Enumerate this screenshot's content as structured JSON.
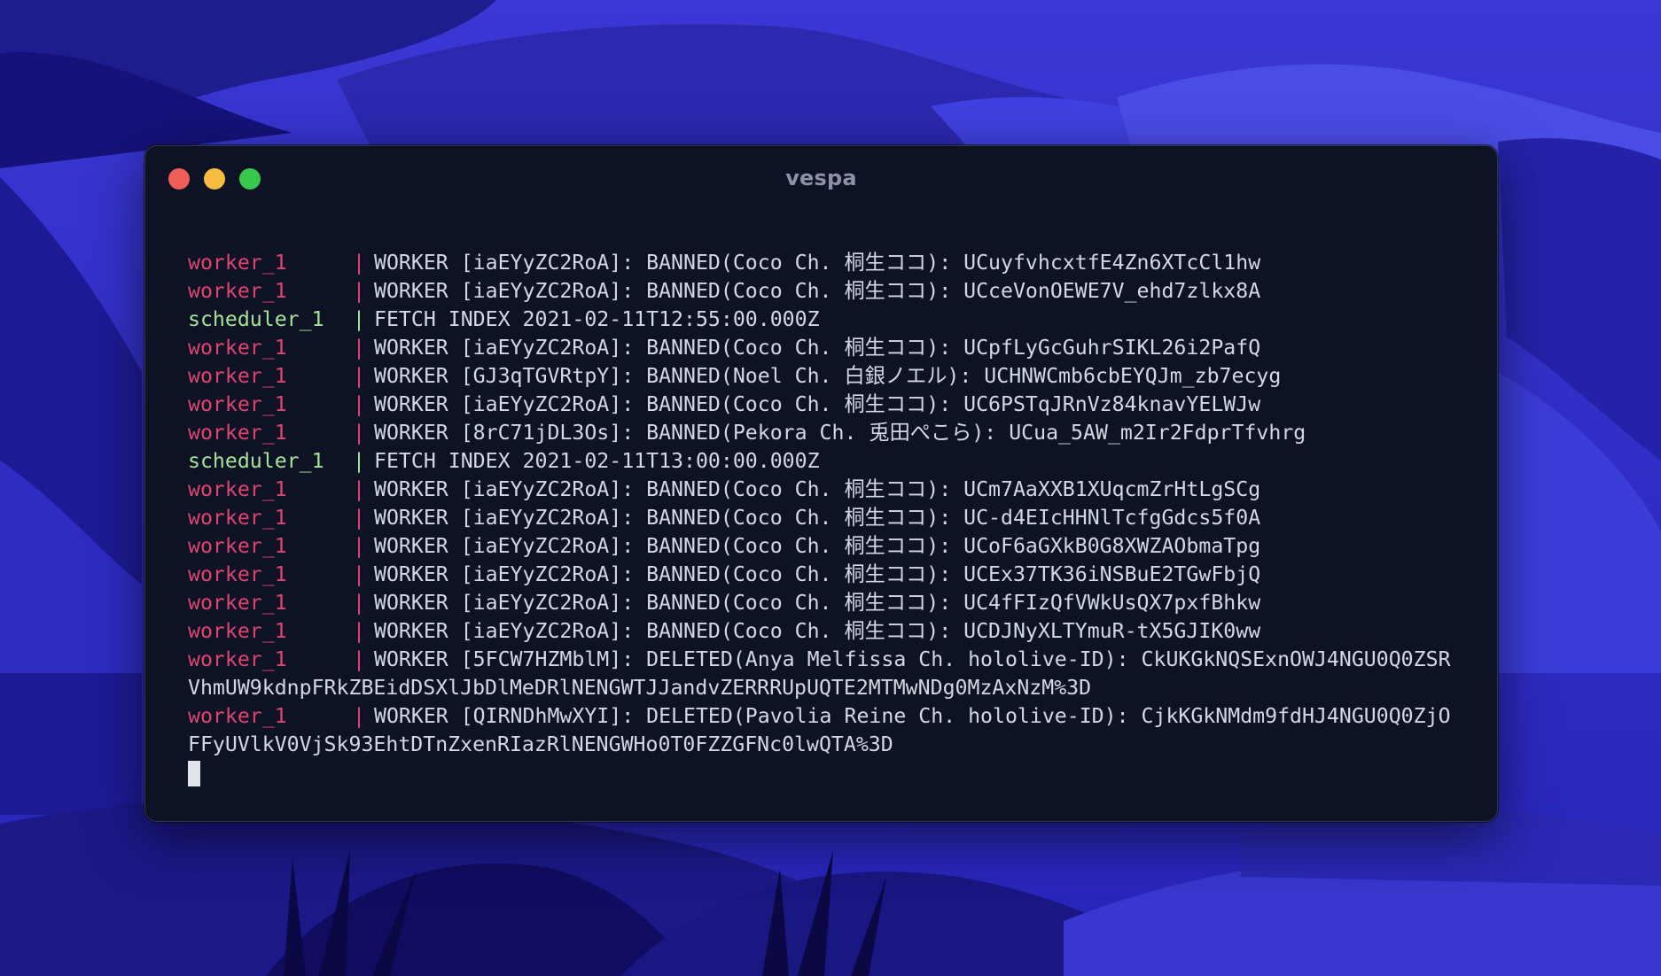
{
  "window": {
    "title": "vespa"
  },
  "colors": {
    "worker": "#e0446f",
    "scheduler": "#a6e39a",
    "text": "#d4d8e2",
    "close": "#f05f57",
    "minimize": "#f7bd42",
    "maximize": "#35c84a"
  },
  "terminal": {
    "lines": [
      {
        "service": "worker_1",
        "kind": "worker",
        "message": "WORKER [iaEYyZC2RoA]: BANNED(Coco Ch. 桐生ココ): UCuyfvhcxtfE4Zn6XTcCl1hw"
      },
      {
        "service": "worker_1",
        "kind": "worker",
        "message": "WORKER [iaEYyZC2RoA]: BANNED(Coco Ch. 桐生ココ): UCceVonOEWE7V_ehd7zlkx8A"
      },
      {
        "service": "scheduler_1",
        "kind": "scheduler",
        "message": "FETCH INDEX 2021-02-11T12:55:00.000Z"
      },
      {
        "service": "worker_1",
        "kind": "worker",
        "message": "WORKER [iaEYyZC2RoA]: BANNED(Coco Ch. 桐生ココ): UCpfLyGcGuhrSIKL26i2PafQ"
      },
      {
        "service": "worker_1",
        "kind": "worker",
        "message": "WORKER [GJ3qTGVRtpY]: BANNED(Noel Ch. 白銀ノエル): UCHNWCmb6cbEYQJm_zb7ecyg"
      },
      {
        "service": "worker_1",
        "kind": "worker",
        "message": "WORKER [iaEYyZC2RoA]: BANNED(Coco Ch. 桐生ココ): UC6PSTqJRnVz84knavYELWJw"
      },
      {
        "service": "worker_1",
        "kind": "worker",
        "message": "WORKER [8rC71jDL3Os]: BANNED(Pekora Ch. 兎田ぺこら): UCua_5AW_m2Ir2FdprTfvhrg"
      },
      {
        "service": "scheduler_1",
        "kind": "scheduler",
        "message": "FETCH INDEX 2021-02-11T13:00:00.000Z"
      },
      {
        "service": "worker_1",
        "kind": "worker",
        "message": "WORKER [iaEYyZC2RoA]: BANNED(Coco Ch. 桐生ココ): UCm7AaXXB1XUqcmZrHtLgSCg"
      },
      {
        "service": "worker_1",
        "kind": "worker",
        "message": "WORKER [iaEYyZC2RoA]: BANNED(Coco Ch. 桐生ココ): UC-d4EIcHHNlTcfgGdcs5f0A"
      },
      {
        "service": "worker_1",
        "kind": "worker",
        "message": "WORKER [iaEYyZC2RoA]: BANNED(Coco Ch. 桐生ココ): UCoF6aGXkB0G8XWZAObmaTpg"
      },
      {
        "service": "worker_1",
        "kind": "worker",
        "message": "WORKER [iaEYyZC2RoA]: BANNED(Coco Ch. 桐生ココ): UCEx37TK36iNSBuE2TGwFbjQ"
      },
      {
        "service": "worker_1",
        "kind": "worker",
        "message": "WORKER [iaEYyZC2RoA]: BANNED(Coco Ch. 桐生ココ): UC4fFIzQfVWkUsQX7pxfBhkw"
      },
      {
        "service": "worker_1",
        "kind": "worker",
        "message": "WORKER [iaEYyZC2RoA]: BANNED(Coco Ch. 桐生ココ): UCDJNyXLTYmuR-tX5GJIK0ww"
      },
      {
        "service": "worker_1",
        "kind": "worker",
        "message": "WORKER [5FCW7HZMblM]: DELETED(Anya Melfissa Ch. hololive-ID): CkUKGkNQSExnOWJ4NGU0Q0ZSR"
      },
      {
        "service": "",
        "kind": "continuation",
        "message": "VhmUW9kdnpFRkZBEidDSXlJbDlMeDRlNENGWTJJandvZERRRUpUQTE2MTMwNDg0MzAxNzM%3D"
      },
      {
        "service": "worker_1",
        "kind": "worker",
        "message": "WORKER [QIRNDhMwXYI]: DELETED(Pavolia Reine Ch. hololive-ID): CjkKGkNMdm9fdHJ4NGU0Q0ZjO"
      },
      {
        "service": "",
        "kind": "continuation",
        "message": "FFyUVlkV0VjSk93EhtDTnZxenRIazRlNENGWHo0T0FZZGFNc0lwQTA%3D"
      }
    ],
    "separator": "|"
  }
}
